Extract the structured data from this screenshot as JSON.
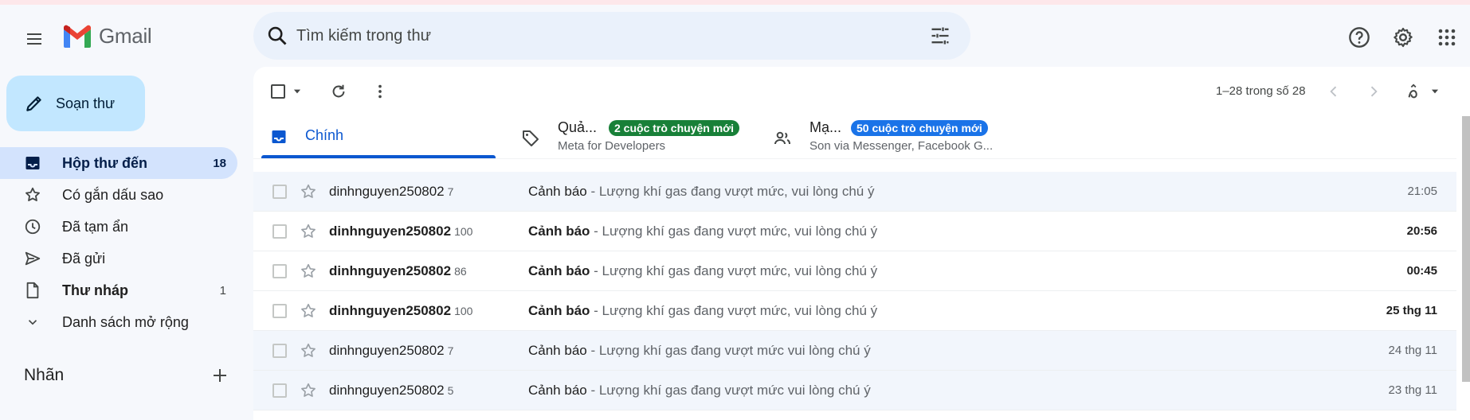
{
  "app": {
    "name": "Gmail"
  },
  "search": {
    "placeholder": "Tìm kiếm trong thư"
  },
  "compose": {
    "label": "Soạn thư"
  },
  "sidebar": {
    "items": [
      {
        "label": "Hộp thư đến",
        "count": "18",
        "icon": "inbox-icon"
      },
      {
        "label": "Có gắn dấu sao",
        "count": "",
        "icon": "star-icon"
      },
      {
        "label": "Đã tạm ẩn",
        "count": "",
        "icon": "clock-icon"
      },
      {
        "label": "Đã gửi",
        "count": "",
        "icon": "send-icon"
      },
      {
        "label": "Thư nháp",
        "count": "1",
        "icon": "draft-icon"
      },
      {
        "label": "Danh sách mở rộng",
        "count": "",
        "icon": "chevron-down-icon"
      }
    ],
    "labels_title": "Nhãn"
  },
  "toolbar": {
    "pager": "1–28 trong số 28"
  },
  "tabs": {
    "primary": {
      "label": "Chính"
    },
    "promotions": {
      "label": "Quả...",
      "chip": "2 cuộc trò chuyện mới",
      "subtitle": "Meta for Developers",
      "chip_color": "#188038"
    },
    "social": {
      "label": "Mạ...",
      "chip": "50 cuộc trò chuyện mới",
      "subtitle": "Son via Messenger, Facebook G...",
      "chip_color": "#1a73e8"
    }
  },
  "emails": [
    {
      "sender": "dinhnguyen250802",
      "count": "7",
      "subject": "Cảnh báo",
      "snippet": " - Lượng khí gas đang vượt mức, vui lòng chú ý",
      "date": "21:05"
    },
    {
      "sender": "dinhnguyen250802",
      "count": "100",
      "subject": "Cảnh báo",
      "snippet": " - Lượng khí gas đang vượt mức, vui lòng chú ý",
      "date": "20:56"
    },
    {
      "sender": "dinhnguyen250802",
      "count": "86",
      "subject": "Cảnh báo",
      "snippet": " - Lượng khí gas đang vượt mức, vui lòng chú ý",
      "date": "00:45"
    },
    {
      "sender": "dinhnguyen250802",
      "count": "100",
      "subject": "Cảnh báo",
      "snippet": " - Lượng khí gas đang vượt mức, vui lòng chú ý",
      "date": "25 thg 11"
    },
    {
      "sender": "dinhnguyen250802",
      "count": "7",
      "subject": "Cảnh báo",
      "snippet": " - Lượng khí gas đang vượt mức vui lòng chú ý",
      "date": "24 thg 11"
    },
    {
      "sender": "dinhnguyen250802",
      "count": "5",
      "subject": "Cảnh báo",
      "snippet": " - Lượng khí gas đang vượt mức vui lòng chú ý",
      "date": "23 thg 11"
    }
  ],
  "colors": {
    "accent": "#0b57d0",
    "compose_bg": "#c2e7ff",
    "active_nav": "#d3e3fd"
  }
}
